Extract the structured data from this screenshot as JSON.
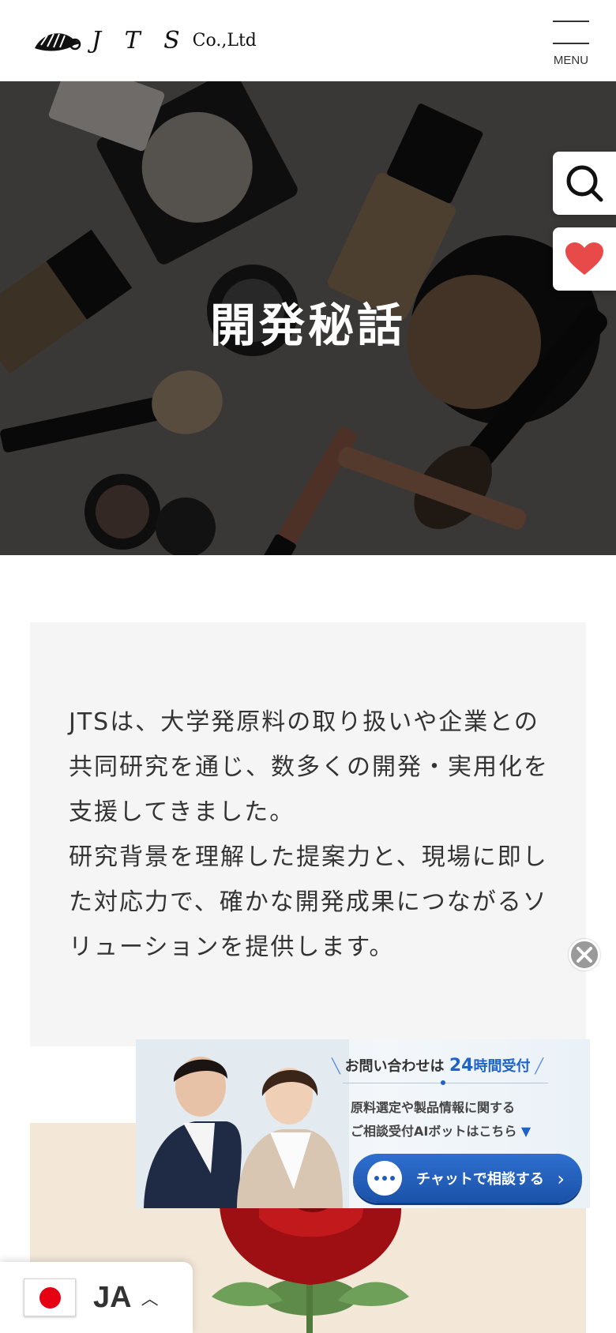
{
  "header": {
    "logo_text": "J T S",
    "logo_sub": "Co.,Ltd",
    "menu_label": "MENU"
  },
  "hero": {
    "title": "開発秘話"
  },
  "side_buttons": {
    "search_icon": "search-icon",
    "favorite_icon": "heart-icon",
    "favorite_color": "#e84a4a"
  },
  "intro": {
    "paragraph1": "JTSは、大学発原料の取り扱いや企業との共同研究を通じ、数多くの開発・実用化を支援してきました。",
    "paragraph2": "研究背景を理解した提案力と、現場に即した対応力で、確かな開発成果につながるソリューションを提供します。"
  },
  "chat_banner": {
    "head_prefix": "お問い合わせは",
    "head_highlight": "24",
    "head_suffix": "時間受付",
    "desc_line1": "原料選定や製品情報に関する",
    "desc_line2": "ご相談受付AIボットはこちら",
    "button_label": "チャットで相談する",
    "accent_color": "#1f63c7"
  },
  "language": {
    "code": "JA",
    "flag": "japan-flag"
  }
}
